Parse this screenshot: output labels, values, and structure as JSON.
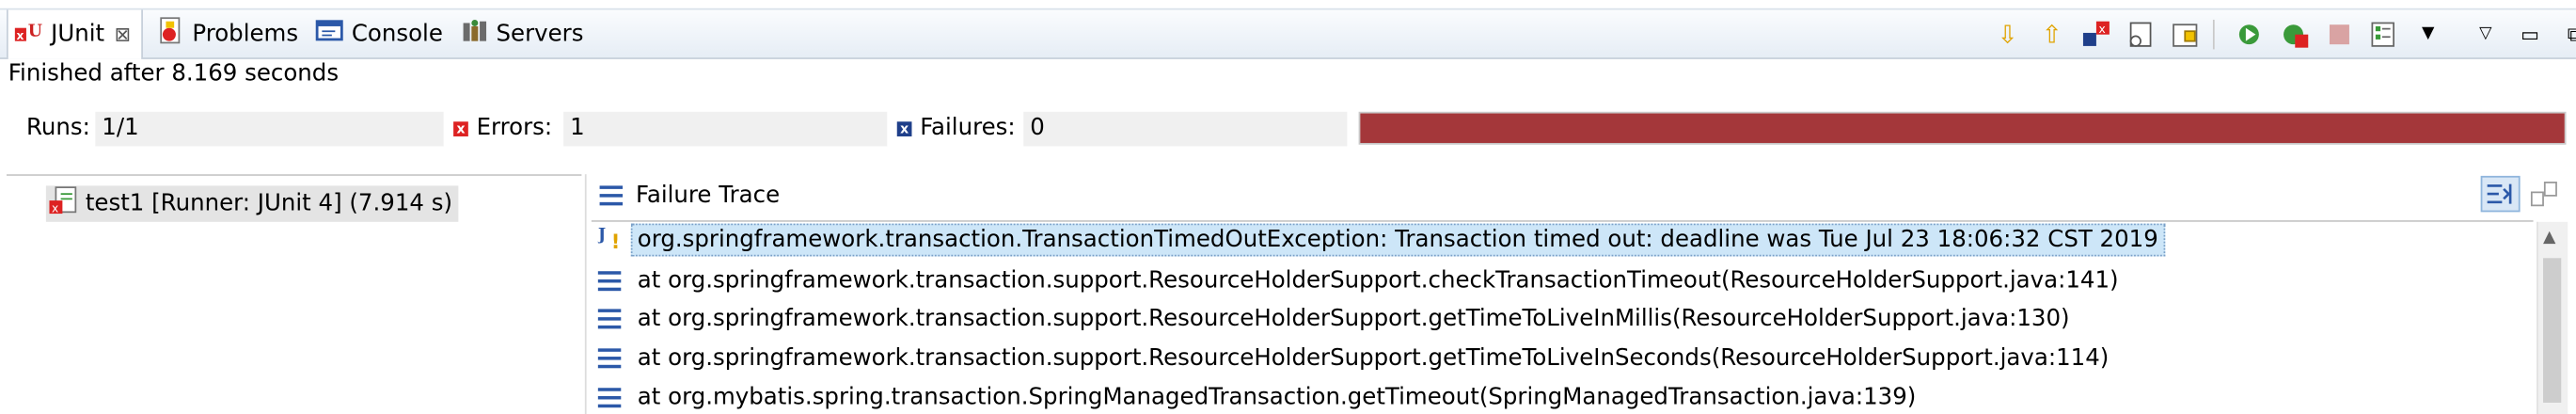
{
  "tabs": [
    {
      "label": "JUnit",
      "close": "⊠",
      "icon": "junit-icon"
    },
    {
      "label": "Problems",
      "icon": "problems-icon"
    },
    {
      "label": "Console",
      "icon": "console-icon"
    },
    {
      "label": "Servers",
      "icon": "servers-icon"
    }
  ],
  "status": {
    "finished": "Finished after 8.169 seconds"
  },
  "counters": {
    "runs_label": "Runs:",
    "runs_value": "1/1",
    "errors_label": "Errors:",
    "errors_value": "1",
    "failures_label": "Failures:",
    "failures_value": "0",
    "progress_fraction": 1.0,
    "progress_color": "#a4373a"
  },
  "tree": {
    "items": [
      {
        "label": "test1 [Runner: JUnit 4] (7.914 s)",
        "icon": "test-error-icon"
      }
    ]
  },
  "trace": {
    "header": "Failure Trace",
    "lines": [
      "org.springframework.transaction.TransactionTimedOutException: Transaction timed out: deadline was Tue Jul 23 18:06:32 CST 2019",
      "at org.springframework.transaction.support.ResourceHolderSupport.checkTransactionTimeout(ResourceHolderSupport.java:141)",
      "at org.springframework.transaction.support.ResourceHolderSupport.getTimeToLiveInMillis(ResourceHolderSupport.java:130)",
      "at org.springframework.transaction.support.ResourceHolderSupport.getTimeToLiveInSeconds(ResourceHolderSupport.java:114)",
      "at org.mybatis.spring.transaction.SpringManagedTransaction.getTimeout(SpringManagedTransaction.java:139)"
    ]
  },
  "colors": {
    "selection": "#cde6f8",
    "accent": "#2b58a8",
    "error": "#d22222"
  }
}
